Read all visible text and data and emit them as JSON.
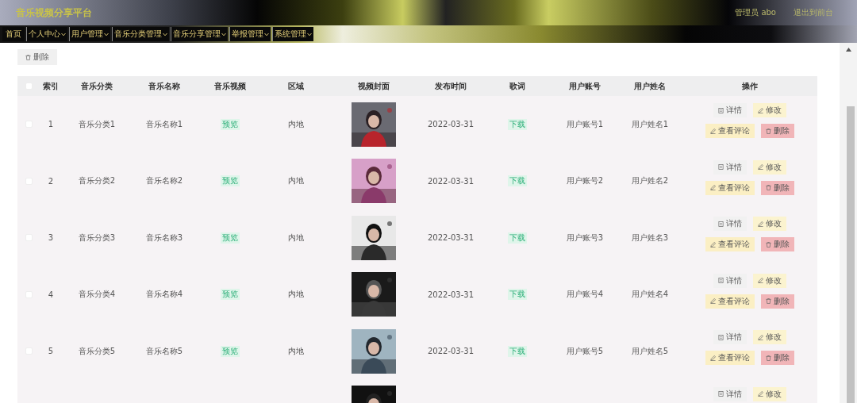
{
  "header": {
    "title": "音乐视频分享平台",
    "user": "管理员 abo",
    "logout": "退出到前台"
  },
  "nav": [
    {
      "label": "首页",
      "dropdown": false
    },
    {
      "label": "个人中心",
      "dropdown": true
    },
    {
      "label": "用户管理",
      "dropdown": true
    },
    {
      "label": "音乐分类管理",
      "dropdown": true
    },
    {
      "label": "音乐分享管理",
      "dropdown": true
    },
    {
      "label": "举报管理",
      "dropdown": true
    },
    {
      "label": "系统管理",
      "dropdown": true
    }
  ],
  "toolbar": {
    "delete_button": "删除"
  },
  "table": {
    "select_all": {
      "checked": false
    },
    "columns": [
      "索引",
      "音乐分类",
      "音乐名称",
      "音乐视频",
      "区域",
      "视频封面",
      "发布时间",
      "歌词",
      "用户账号",
      "用户姓名",
      "操作"
    ],
    "rows": [
      {
        "checked": false,
        "index": "1",
        "category": "音乐分类1",
        "name": "音乐名称1",
        "video": "预览",
        "region": "内地",
        "date": "2022-03-31",
        "lyrics": "下载",
        "account": "用户账号1",
        "user_name": "用户姓名1",
        "actions": [
          "详情",
          "修改",
          "查看评论",
          "删除"
        ]
      },
      {
        "checked": false,
        "index": "2",
        "category": "音乐分类2",
        "name": "音乐名称2",
        "video": "预览",
        "region": "内地",
        "date": "2022-03-31",
        "lyrics": "下载",
        "account": "用户账号2",
        "user_name": "用户姓名2",
        "actions": [
          "详情",
          "修改",
          "查看评论",
          "删除"
        ]
      },
      {
        "checked": false,
        "index": "3",
        "category": "音乐分类3",
        "name": "音乐名称3",
        "video": "预览",
        "region": "内地",
        "date": "2022-03-31",
        "lyrics": "下载",
        "account": "用户账号3",
        "user_name": "用户姓名3",
        "actions": [
          "详情",
          "修改",
          "查看评论",
          "删除"
        ]
      },
      {
        "checked": false,
        "index": "4",
        "category": "音乐分类4",
        "name": "音乐名称4",
        "video": "预览",
        "region": "内地",
        "date": "2022-03-31",
        "lyrics": "下载",
        "account": "用户账号4",
        "user_name": "用户姓名4",
        "actions": [
          "详情",
          "修改",
          "查看评论",
          "删除"
        ]
      },
      {
        "checked": false,
        "index": "5",
        "category": "音乐分类5",
        "name": "音乐名称5",
        "video": "预览",
        "region": "内地",
        "date": "2022-03-31",
        "lyrics": "下载",
        "account": "用户账号5",
        "user_name": "用户姓名5",
        "actions": [
          "详情",
          "修改",
          "查看评论",
          "删除"
        ]
      },
      {
        "actions": [
          "详情",
          "修改"
        ]
      }
    ]
  }
}
